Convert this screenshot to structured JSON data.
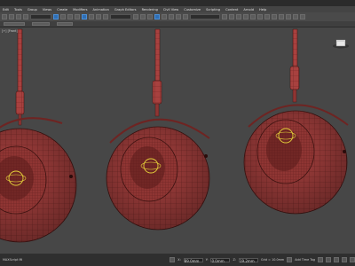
{
  "menubar": {
    "items": [
      "Edit",
      "Tools",
      "Group",
      "Views",
      "Create",
      "Modifiers",
      "Animation",
      "Graph Editors",
      "Rendering",
      "Civil View",
      "Customize",
      "Scripting",
      "Content",
      "Arnold",
      "Help"
    ]
  },
  "toolbar": {
    "selection_filter": "All",
    "view_dropdown": "View",
    "selection_set": "Create Selection Se"
  },
  "viewport": {
    "label": "[+] [Front]"
  },
  "status": {
    "x_label": "X:",
    "x_value": "89.0mm",
    "y_label": "Y:",
    "y_value": "0.0mm",
    "z_label": "Z:",
    "z_value": "19.2mm",
    "grid": "Grid = 10.0mm",
    "add_time_tag": "Add Time Tag",
    "script_label": "MAXScript Mi"
  },
  "colors": {
    "lamp_fill": "#a8413f",
    "lamp_dark": "#6e2422",
    "wire": "#3b1210",
    "gizmo": "#e6d23a",
    "viewport_bg": "#474747"
  }
}
